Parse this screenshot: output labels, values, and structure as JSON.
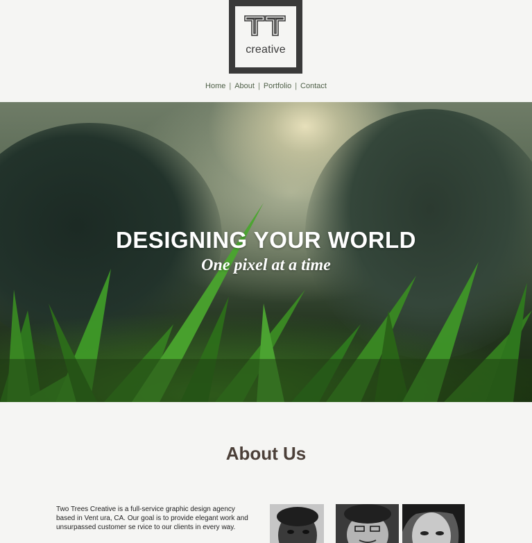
{
  "logo": {
    "mark": "TT",
    "word": "creative"
  },
  "nav": {
    "items": [
      "Home",
      "About",
      "Portfolio",
      "Contact"
    ],
    "separator": "|"
  },
  "hero": {
    "title": "DESIGNING YOUR WORLD",
    "subtitle": "One pixel at a time"
  },
  "about": {
    "heading": "About Us",
    "body": "Two Trees Creative is a full-service graphic design agency based in Vent ura, CA. Our goal is to provide elegant work and unsurpassed customer se rvice to our clients in every way."
  },
  "colors": {
    "background": "#f5f5f3",
    "logo_frame": "#3a3a3a",
    "nav_link": "#4f6048",
    "heading": "#4b3f38"
  }
}
